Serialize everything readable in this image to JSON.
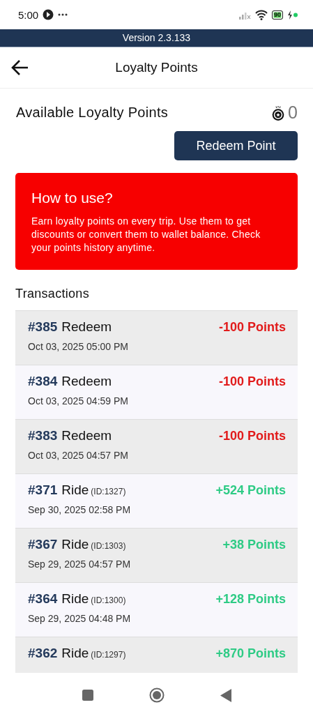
{
  "status_bar": {
    "time": "5:00",
    "battery": "90"
  },
  "version_banner": "Version 2.3.133",
  "header": {
    "title": "Loyalty Points"
  },
  "summary": {
    "label": "Available Loyalty Points",
    "points": "0",
    "button": "Redeem Point"
  },
  "info_card": {
    "title": "How to use?",
    "text": "Earn loyalty points on every trip. Use them to get discounts or convert them to wallet balance. Check your points history anytime."
  },
  "transactions": {
    "title": "Transactions",
    "rows": [
      {
        "kind": "redeem",
        "number": "#385",
        "type": "Redeem",
        "date": "Oct 03, 2025 05:00 PM",
        "points": "-100 Points"
      },
      {
        "kind": "redeem",
        "number": "#384",
        "type": "Redeem",
        "date": "Oct 03, 2025 04:59 PM",
        "points": "-100 Points"
      },
      {
        "kind": "redeem",
        "number": "#383",
        "type": "Redeem",
        "date": "Oct 03, 2025 04:57 PM",
        "points": "-100 Points"
      },
      {
        "kind": "ride",
        "number": "#371",
        "type": "Ride",
        "ride_id": "(ID:1327)",
        "date": "Sep 30, 2025 02:58 PM",
        "points": "+524 Points"
      },
      {
        "kind": "ride",
        "number": "#367",
        "type": "Ride",
        "ride_id": "(ID:1303)",
        "date": "Sep 29, 2025 04:57 PM",
        "points": "+38 Points"
      },
      {
        "kind": "ride",
        "number": "#364",
        "type": "Ride",
        "ride_id": "(ID:1300)",
        "date": "Sep 29, 2025 04:48 PM",
        "points": "+128 Points"
      },
      {
        "kind": "ride",
        "number": "#362",
        "type": "Ride",
        "ride_id": "(ID:1297)",
        "points": "+870 Points"
      }
    ]
  }
}
